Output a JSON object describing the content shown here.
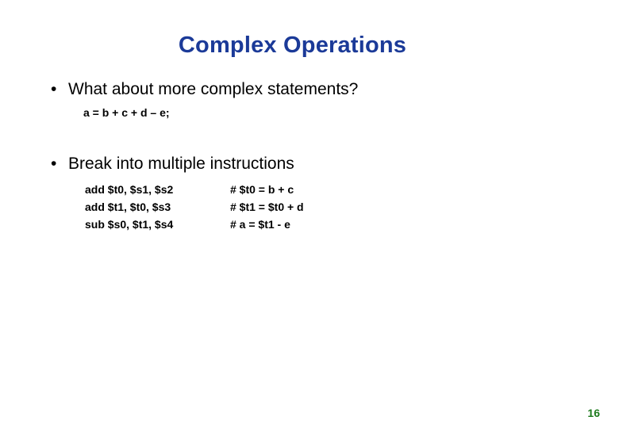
{
  "slide": {
    "title": "Complex Operations",
    "title_color": "#1b3a98",
    "background_color": "#ffffff",
    "page_number": "16",
    "page_number_color": "#1c7a1c"
  },
  "bullets": [
    {
      "marker": "•",
      "text": "What about more complex statements?"
    },
    {
      "marker": "•",
      "text": "Break into multiple instructions"
    }
  ],
  "expression": "a = b + c + d – e;",
  "code": {
    "rows": [
      {
        "instruction": "add $t0, $s1, $s2",
        "comment": "# $t0 = b + c"
      },
      {
        "instruction": "add $t1, $t0, $s3",
        "comment": "# $t1 = $t0 + d"
      },
      {
        "instruction": "sub $s0, $t1, $s4",
        "comment": "# a = $t1 - e"
      }
    ]
  }
}
